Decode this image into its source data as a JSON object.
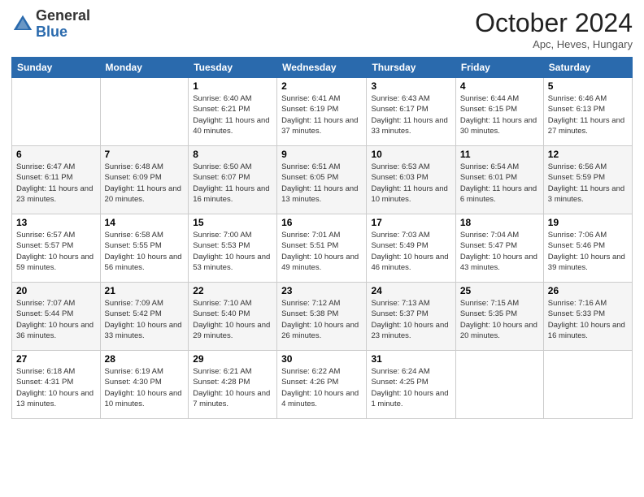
{
  "header": {
    "logo_general": "General",
    "logo_blue": "Blue",
    "month_title": "October 2024",
    "location": "Apc, Heves, Hungary"
  },
  "columns": [
    "Sunday",
    "Monday",
    "Tuesday",
    "Wednesday",
    "Thursday",
    "Friday",
    "Saturday"
  ],
  "weeks": [
    [
      {
        "day": "",
        "info": ""
      },
      {
        "day": "",
        "info": ""
      },
      {
        "day": "1",
        "info": "Sunrise: 6:40 AM\nSunset: 6:21 PM\nDaylight: 11 hours and 40 minutes."
      },
      {
        "day": "2",
        "info": "Sunrise: 6:41 AM\nSunset: 6:19 PM\nDaylight: 11 hours and 37 minutes."
      },
      {
        "day": "3",
        "info": "Sunrise: 6:43 AM\nSunset: 6:17 PM\nDaylight: 11 hours and 33 minutes."
      },
      {
        "day": "4",
        "info": "Sunrise: 6:44 AM\nSunset: 6:15 PM\nDaylight: 11 hours and 30 minutes."
      },
      {
        "day": "5",
        "info": "Sunrise: 6:46 AM\nSunset: 6:13 PM\nDaylight: 11 hours and 27 minutes."
      }
    ],
    [
      {
        "day": "6",
        "info": "Sunrise: 6:47 AM\nSunset: 6:11 PM\nDaylight: 11 hours and 23 minutes."
      },
      {
        "day": "7",
        "info": "Sunrise: 6:48 AM\nSunset: 6:09 PM\nDaylight: 11 hours and 20 minutes."
      },
      {
        "day": "8",
        "info": "Sunrise: 6:50 AM\nSunset: 6:07 PM\nDaylight: 11 hours and 16 minutes."
      },
      {
        "day": "9",
        "info": "Sunrise: 6:51 AM\nSunset: 6:05 PM\nDaylight: 11 hours and 13 minutes."
      },
      {
        "day": "10",
        "info": "Sunrise: 6:53 AM\nSunset: 6:03 PM\nDaylight: 11 hours and 10 minutes."
      },
      {
        "day": "11",
        "info": "Sunrise: 6:54 AM\nSunset: 6:01 PM\nDaylight: 11 hours and 6 minutes."
      },
      {
        "day": "12",
        "info": "Sunrise: 6:56 AM\nSunset: 5:59 PM\nDaylight: 11 hours and 3 minutes."
      }
    ],
    [
      {
        "day": "13",
        "info": "Sunrise: 6:57 AM\nSunset: 5:57 PM\nDaylight: 10 hours and 59 minutes."
      },
      {
        "day": "14",
        "info": "Sunrise: 6:58 AM\nSunset: 5:55 PM\nDaylight: 10 hours and 56 minutes."
      },
      {
        "day": "15",
        "info": "Sunrise: 7:00 AM\nSunset: 5:53 PM\nDaylight: 10 hours and 53 minutes."
      },
      {
        "day": "16",
        "info": "Sunrise: 7:01 AM\nSunset: 5:51 PM\nDaylight: 10 hours and 49 minutes."
      },
      {
        "day": "17",
        "info": "Sunrise: 7:03 AM\nSunset: 5:49 PM\nDaylight: 10 hours and 46 minutes."
      },
      {
        "day": "18",
        "info": "Sunrise: 7:04 AM\nSunset: 5:47 PM\nDaylight: 10 hours and 43 minutes."
      },
      {
        "day": "19",
        "info": "Sunrise: 7:06 AM\nSunset: 5:46 PM\nDaylight: 10 hours and 39 minutes."
      }
    ],
    [
      {
        "day": "20",
        "info": "Sunrise: 7:07 AM\nSunset: 5:44 PM\nDaylight: 10 hours and 36 minutes."
      },
      {
        "day": "21",
        "info": "Sunrise: 7:09 AM\nSunset: 5:42 PM\nDaylight: 10 hours and 33 minutes."
      },
      {
        "day": "22",
        "info": "Sunrise: 7:10 AM\nSunset: 5:40 PM\nDaylight: 10 hours and 29 minutes."
      },
      {
        "day": "23",
        "info": "Sunrise: 7:12 AM\nSunset: 5:38 PM\nDaylight: 10 hours and 26 minutes."
      },
      {
        "day": "24",
        "info": "Sunrise: 7:13 AM\nSunset: 5:37 PM\nDaylight: 10 hours and 23 minutes."
      },
      {
        "day": "25",
        "info": "Sunrise: 7:15 AM\nSunset: 5:35 PM\nDaylight: 10 hours and 20 minutes."
      },
      {
        "day": "26",
        "info": "Sunrise: 7:16 AM\nSunset: 5:33 PM\nDaylight: 10 hours and 16 minutes."
      }
    ],
    [
      {
        "day": "27",
        "info": "Sunrise: 6:18 AM\nSunset: 4:31 PM\nDaylight: 10 hours and 13 minutes."
      },
      {
        "day": "28",
        "info": "Sunrise: 6:19 AM\nSunset: 4:30 PM\nDaylight: 10 hours and 10 minutes."
      },
      {
        "day": "29",
        "info": "Sunrise: 6:21 AM\nSunset: 4:28 PM\nDaylight: 10 hours and 7 minutes."
      },
      {
        "day": "30",
        "info": "Sunrise: 6:22 AM\nSunset: 4:26 PM\nDaylight: 10 hours and 4 minutes."
      },
      {
        "day": "31",
        "info": "Sunrise: 6:24 AM\nSunset: 4:25 PM\nDaylight: 10 hours and 1 minute."
      },
      {
        "day": "",
        "info": ""
      },
      {
        "day": "",
        "info": ""
      }
    ]
  ]
}
